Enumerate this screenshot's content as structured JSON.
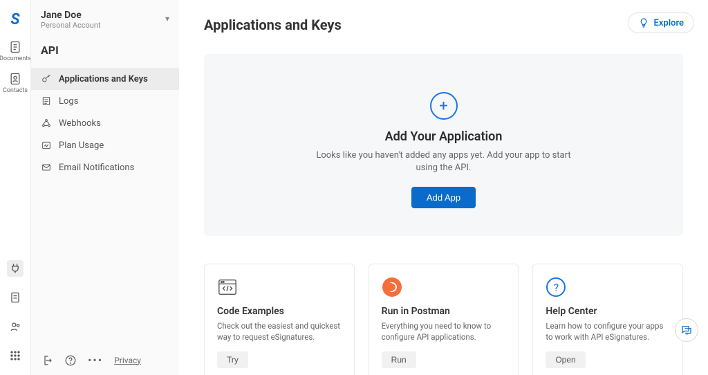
{
  "account": {
    "name": "Jane Doe",
    "subtitle": "Personal Account"
  },
  "rail": {
    "items": [
      {
        "label": "Documents"
      },
      {
        "label": "Contacts"
      }
    ]
  },
  "sidebar": {
    "title": "API",
    "items": [
      {
        "label": "Applications and Keys"
      },
      {
        "label": "Logs"
      },
      {
        "label": "Webhooks"
      },
      {
        "label": "Plan Usage"
      },
      {
        "label": "Email Notifications"
      }
    ],
    "privacy": "Privacy"
  },
  "header": {
    "title": "Applications and Keys",
    "explore": "Explore"
  },
  "hero": {
    "title": "Add Your Application",
    "body": "Looks like you haven't added any apps yet. Add your app to start using the API.",
    "cta": "Add App"
  },
  "cards": [
    {
      "title": "Code Examples",
      "body": "Check out the easiest and quickest way to request eSignatures.",
      "action": "Try"
    },
    {
      "title": "Run in Postman",
      "body": "Everything you need to know to configure API applications.",
      "action": "Run"
    },
    {
      "title": "Help Center",
      "body": "Learn how to configure your apps to work with API eSignatures.",
      "action": "Open"
    }
  ]
}
